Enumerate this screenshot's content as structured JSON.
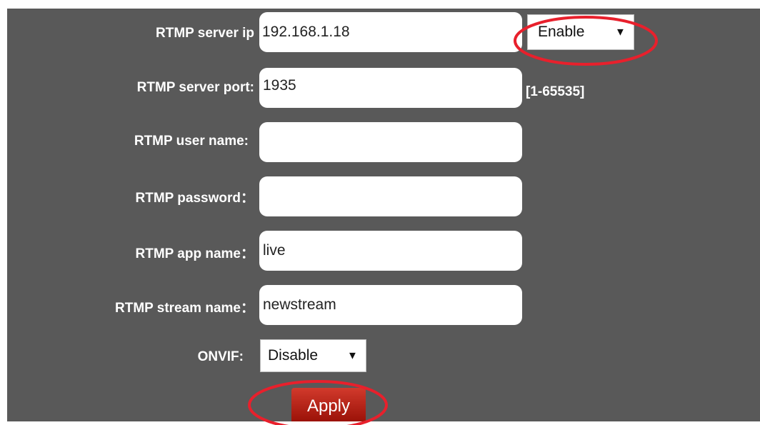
{
  "rtmp_server_ip": {
    "label": "RTMP server ip",
    "value": "192.168.1.18",
    "status_selected": "Enable"
  },
  "rtmp_server_port": {
    "label": "RTMP server port:",
    "value": "1935",
    "range_hint": "[1-65535]"
  },
  "rtmp_user_name": {
    "label": "RTMP user name:",
    "value": ""
  },
  "rtmp_password": {
    "label": "RTMP password：",
    "value": ""
  },
  "rtmp_app_name": {
    "label": "RTMP app name：",
    "value": "live"
  },
  "rtmp_stream_name": {
    "label": "RTMP stream name：",
    "value": "newstream"
  },
  "onvif": {
    "label": "ONVIF:",
    "selected": "Disable"
  },
  "apply_label": "Apply",
  "colors": {
    "panel_background": "#595959",
    "apply_button": "#b5200f",
    "annotation_circle": "#e8202c"
  },
  "icons": {
    "dropdown": "triangle-down-icon"
  }
}
